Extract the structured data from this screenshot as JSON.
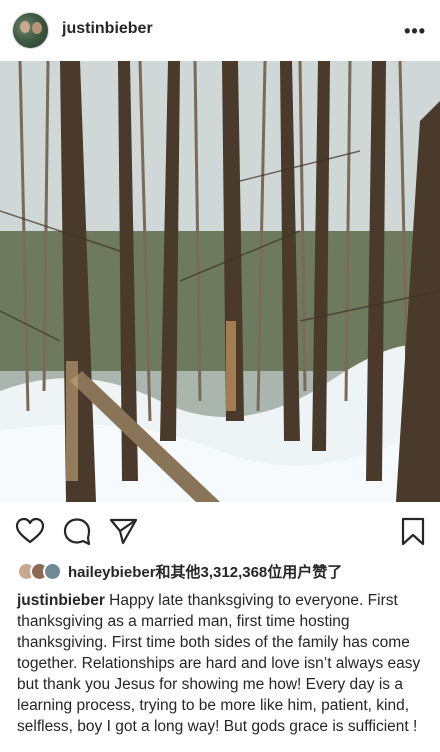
{
  "post": {
    "username": "justinbieber",
    "more_icon": "more-horizontal-icon"
  },
  "photo": {
    "subject": "snowy forest with tall conifer trunks"
  },
  "actions": {
    "like_icon": "heart-icon",
    "comment_icon": "comment-icon",
    "share_icon": "send-icon",
    "save_icon": "bookmark-icon"
  },
  "likes": {
    "text": "haileybieber和其他3,312,368位用户赞了"
  },
  "caption": {
    "username": "justinbieber",
    "text": "Happy late thanksgiving to everyone. First thanksgiving as a married man, first time hosting thanksgiving. First time both sides of the family has come together. Relationships are hard and love isn’t always easy but thank you Jesus for showing me how! Every day is a learning process, trying to be more like him, patient, kind, selfless, boy I got a long way! But gods grace is sufficient !"
  },
  "colors": {
    "text": "#262626",
    "snow": "#f1f5f8",
    "trunk": "#4a3a2c"
  }
}
